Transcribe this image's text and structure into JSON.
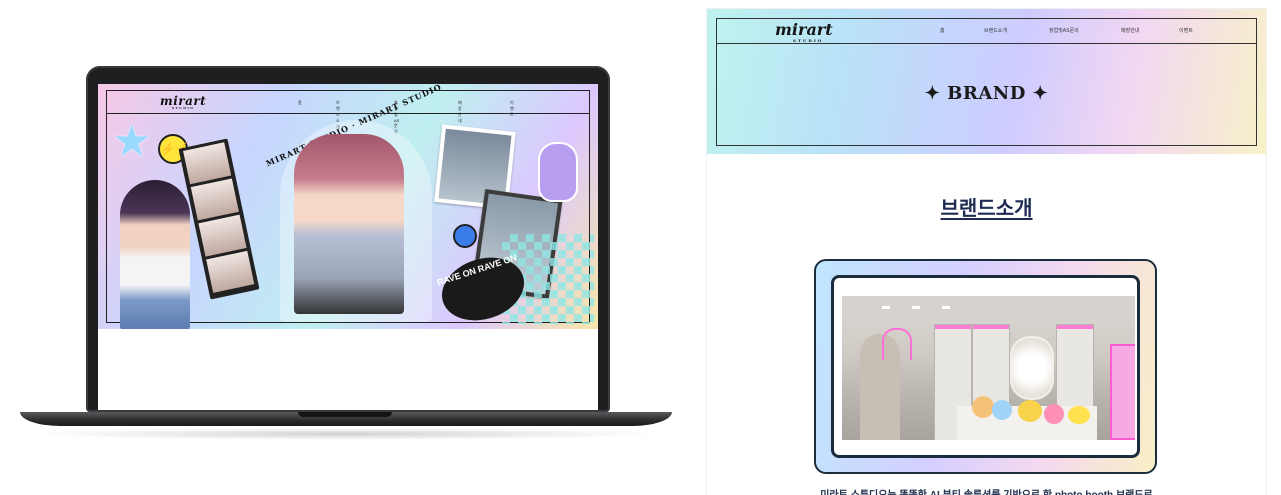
{
  "laptop_site": {
    "logo_text": "mirart",
    "logo_sub": "STUDIO",
    "nav": [
      "홈",
      "브랜드소개",
      "창업및AS문의",
      "매장안내",
      "이벤트"
    ],
    "hero_text": "MIRART STUDIO · MIRART STUDIO",
    "smiley": "⚡⚡",
    "rave_text": "RAVE ON RAVE ON"
  },
  "page": {
    "logo_text": "mirart",
    "logo_sub": "STUDIO",
    "nav": [
      "홈",
      "브랜드소개",
      "창업및AS문의",
      "매장안내",
      "이벤트"
    ],
    "banner_title": "✦ BRAND ✦",
    "section_heading": "브랜드소개",
    "caption": "미라트 스튜디오는 똑똑한 AI 뷰티 솔루션를 기반으로 한 photo booth 브랜드로"
  },
  "colors": {
    "accent_pink": "#ff6fd8",
    "navy": "#1e2a52",
    "frame_dark": "#1b2d3c"
  }
}
